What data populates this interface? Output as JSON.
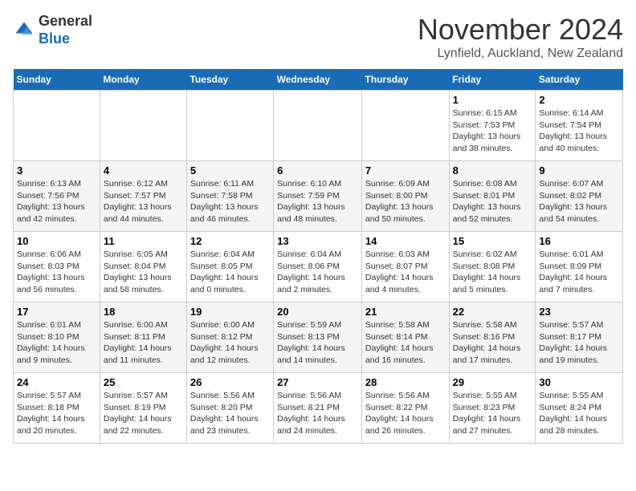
{
  "header": {
    "logo_general": "General",
    "logo_blue": "Blue",
    "month": "November 2024",
    "location": "Lynfield, Auckland, New Zealand"
  },
  "days_of_week": [
    "Sunday",
    "Monday",
    "Tuesday",
    "Wednesday",
    "Thursday",
    "Friday",
    "Saturday"
  ],
  "weeks": [
    [
      {
        "day": "",
        "content": ""
      },
      {
        "day": "",
        "content": ""
      },
      {
        "day": "",
        "content": ""
      },
      {
        "day": "",
        "content": ""
      },
      {
        "day": "",
        "content": ""
      },
      {
        "day": "1",
        "content": "Sunrise: 6:15 AM\nSunset: 7:53 PM\nDaylight: 13 hours and 38 minutes."
      },
      {
        "day": "2",
        "content": "Sunrise: 6:14 AM\nSunset: 7:54 PM\nDaylight: 13 hours and 40 minutes."
      }
    ],
    [
      {
        "day": "3",
        "content": "Sunrise: 6:13 AM\nSunset: 7:56 PM\nDaylight: 13 hours and 42 minutes."
      },
      {
        "day": "4",
        "content": "Sunrise: 6:12 AM\nSunset: 7:57 PM\nDaylight: 13 hours and 44 minutes."
      },
      {
        "day": "5",
        "content": "Sunrise: 6:11 AM\nSunset: 7:58 PM\nDaylight: 13 hours and 46 minutes."
      },
      {
        "day": "6",
        "content": "Sunrise: 6:10 AM\nSunset: 7:59 PM\nDaylight: 13 hours and 48 minutes."
      },
      {
        "day": "7",
        "content": "Sunrise: 6:09 AM\nSunset: 8:00 PM\nDaylight: 13 hours and 50 minutes."
      },
      {
        "day": "8",
        "content": "Sunrise: 6:08 AM\nSunset: 8:01 PM\nDaylight: 13 hours and 52 minutes."
      },
      {
        "day": "9",
        "content": "Sunrise: 6:07 AM\nSunset: 8:02 PM\nDaylight: 13 hours and 54 minutes."
      }
    ],
    [
      {
        "day": "10",
        "content": "Sunrise: 6:06 AM\nSunset: 8:03 PM\nDaylight: 13 hours and 56 minutes."
      },
      {
        "day": "11",
        "content": "Sunrise: 6:05 AM\nSunset: 8:04 PM\nDaylight: 13 hours and 58 minutes."
      },
      {
        "day": "12",
        "content": "Sunrise: 6:04 AM\nSunset: 8:05 PM\nDaylight: 14 hours and 0 minutes."
      },
      {
        "day": "13",
        "content": "Sunrise: 6:04 AM\nSunset: 8:06 PM\nDaylight: 14 hours and 2 minutes."
      },
      {
        "day": "14",
        "content": "Sunrise: 6:03 AM\nSunset: 8:07 PM\nDaylight: 14 hours and 4 minutes."
      },
      {
        "day": "15",
        "content": "Sunrise: 6:02 AM\nSunset: 8:08 PM\nDaylight: 14 hours and 5 minutes."
      },
      {
        "day": "16",
        "content": "Sunrise: 6:01 AM\nSunset: 8:09 PM\nDaylight: 14 hours and 7 minutes."
      }
    ],
    [
      {
        "day": "17",
        "content": "Sunrise: 6:01 AM\nSunset: 8:10 PM\nDaylight: 14 hours and 9 minutes."
      },
      {
        "day": "18",
        "content": "Sunrise: 6:00 AM\nSunset: 8:11 PM\nDaylight: 14 hours and 11 minutes."
      },
      {
        "day": "19",
        "content": "Sunrise: 6:00 AM\nSunset: 8:12 PM\nDaylight: 14 hours and 12 minutes."
      },
      {
        "day": "20",
        "content": "Sunrise: 5:59 AM\nSunset: 8:13 PM\nDaylight: 14 hours and 14 minutes."
      },
      {
        "day": "21",
        "content": "Sunrise: 5:58 AM\nSunset: 8:14 PM\nDaylight: 14 hours and 16 minutes."
      },
      {
        "day": "22",
        "content": "Sunrise: 5:58 AM\nSunset: 8:16 PM\nDaylight: 14 hours and 17 minutes."
      },
      {
        "day": "23",
        "content": "Sunrise: 5:57 AM\nSunset: 8:17 PM\nDaylight: 14 hours and 19 minutes."
      }
    ],
    [
      {
        "day": "24",
        "content": "Sunrise: 5:57 AM\nSunset: 8:18 PM\nDaylight: 14 hours and 20 minutes."
      },
      {
        "day": "25",
        "content": "Sunrise: 5:57 AM\nSunset: 8:19 PM\nDaylight: 14 hours and 22 minutes."
      },
      {
        "day": "26",
        "content": "Sunrise: 5:56 AM\nSunset: 8:20 PM\nDaylight: 14 hours and 23 minutes."
      },
      {
        "day": "27",
        "content": "Sunrise: 5:56 AM\nSunset: 8:21 PM\nDaylight: 14 hours and 24 minutes."
      },
      {
        "day": "28",
        "content": "Sunrise: 5:56 AM\nSunset: 8:22 PM\nDaylight: 14 hours and 26 minutes."
      },
      {
        "day": "29",
        "content": "Sunrise: 5:55 AM\nSunset: 8:23 PM\nDaylight: 14 hours and 27 minutes."
      },
      {
        "day": "30",
        "content": "Sunrise: 5:55 AM\nSunset: 8:24 PM\nDaylight: 14 hours and 28 minutes."
      }
    ]
  ]
}
